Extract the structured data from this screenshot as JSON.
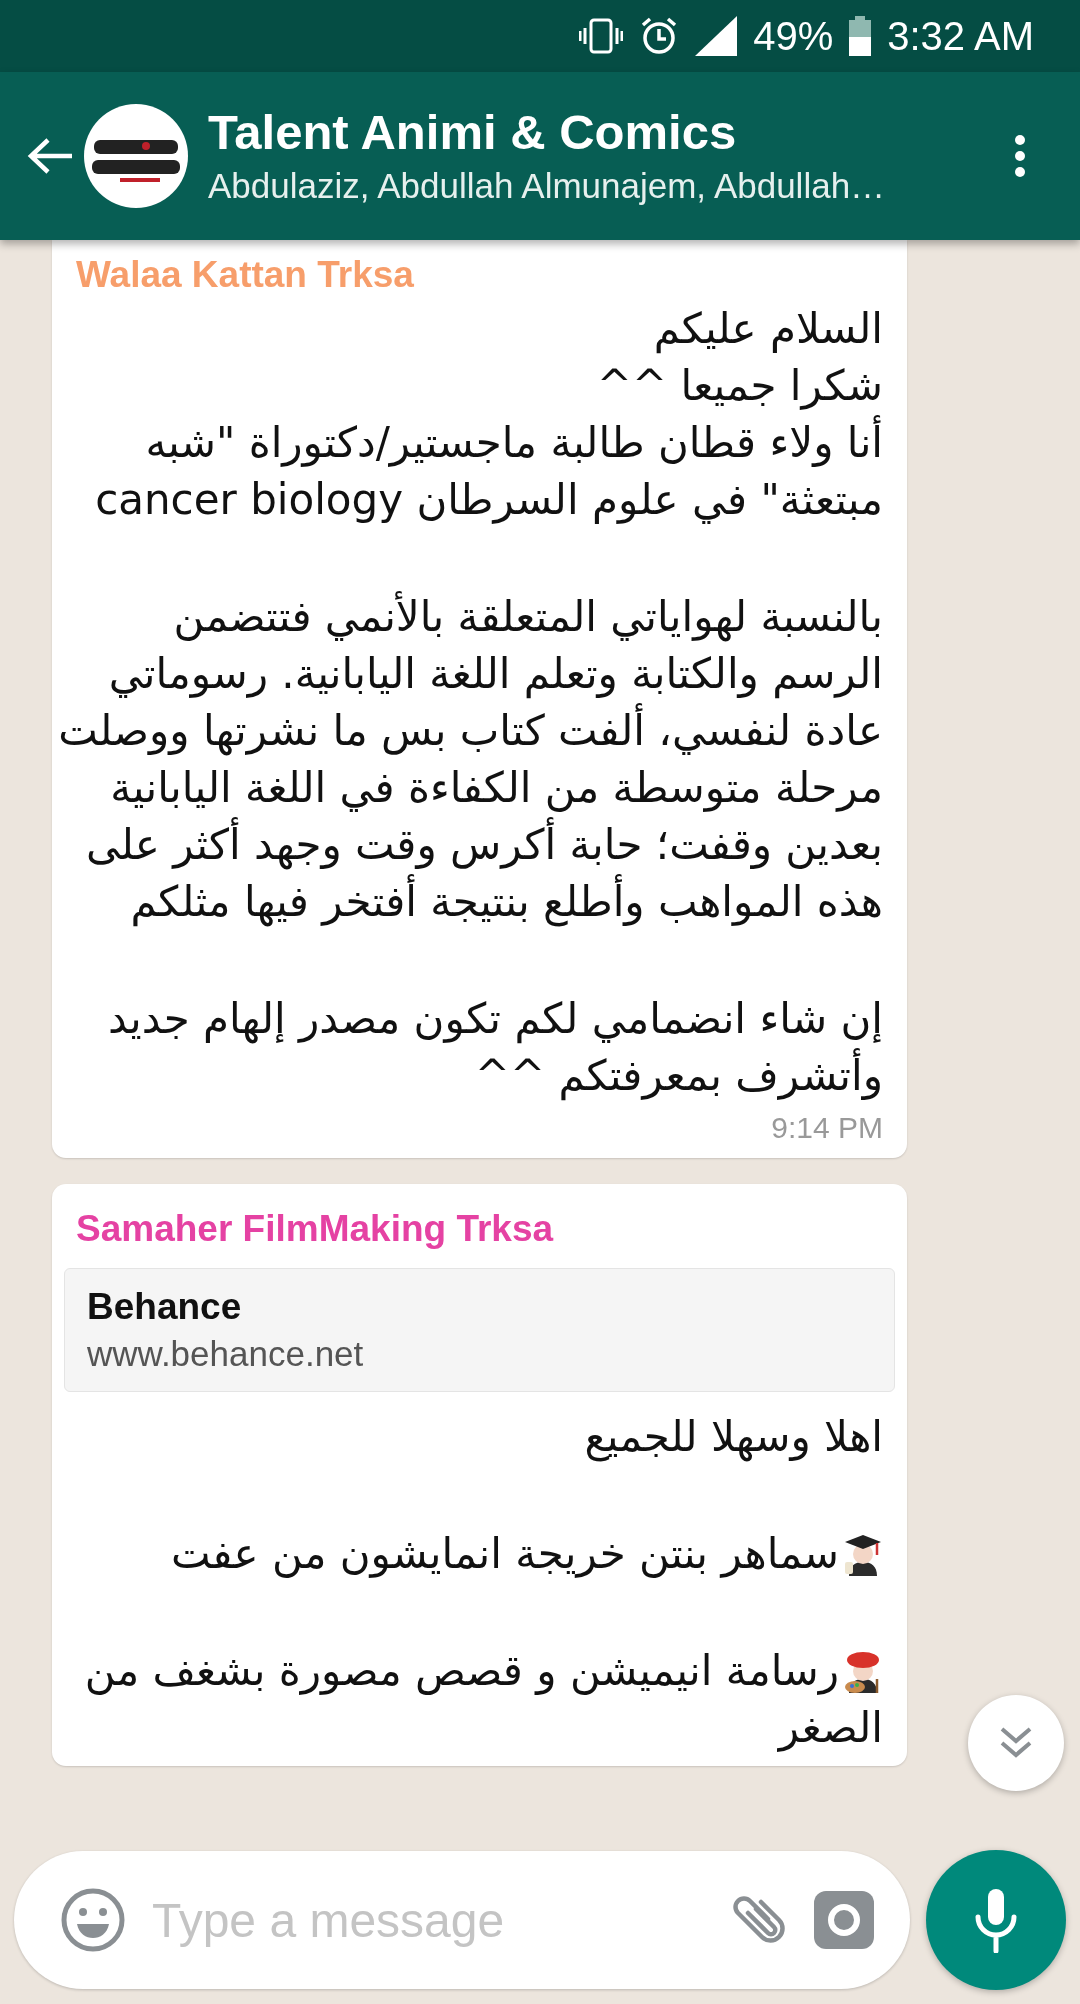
{
  "status_bar": {
    "battery": "49%",
    "time": "3:32 AM"
  },
  "header": {
    "title": "Talent Animi & Comics",
    "subtitle": "Abdulaziz, Abdullah Almunajem, Abdullah…"
  },
  "messages": [
    {
      "sender": "Walaa Kattan Trksa",
      "color": "#f79e6b",
      "paragraphs": [
        {
          "lines": [
            {
              "text": "السلام عليكم"
            },
            {
              "text": "شكرا جميعا ^^"
            },
            {
              "text": "أنا ولاء قطان طالبة ماجستير/دكتوراة \"شبه"
            },
            {
              "text": "مبتعثة\" في علوم السرطان cancer biology"
            }
          ]
        },
        {
          "lines": [
            {
              "text": "بالنسبة لهواياتي المتعلقة بالأنمي فتتضمن"
            },
            {
              "text": "الرسم والكتابة وتعلم اللغة اليابانية. رسوماتي"
            },
            {
              "text": "عادة لنفسي، ألفت كتاب بس ما نشرتها ووصلت"
            },
            {
              "text": "مرحلة متوسطة من الكفاءة في اللغة اليابانية"
            },
            {
              "text": "بعدين وقفت؛ حابة أكرس وقت وجهد أكثر على"
            },
            {
              "text": "هذه المواهب وأطلع بنتيجة أفتخر فيها مثلكم"
            }
          ]
        },
        {
          "lines": [
            {
              "text": "إن شاء انضمامي لكم تكون مصدر إلهام جديد"
            },
            {
              "text": "وأتشرف بمعرفتكم ^^"
            }
          ]
        }
      ],
      "time": "9:14 PM"
    },
    {
      "sender": "Samaher FilmMaking Trksa",
      "color": "#e542a3",
      "link_preview": {
        "title": "Behance",
        "url": "www.behance.net"
      },
      "paragraphs": [
        {
          "lines": [
            {
              "text": "اهلا وسهلا للجميع"
            }
          ]
        },
        {
          "lines": [
            {
              "text": "سماهر بنتن خريجة انمايشون من عفت",
              "kind": "graduate"
            }
          ]
        },
        {
          "lines": [
            {
              "text": "رسامة انيميشن و قصص مصورة بشغف من",
              "kind": "artist"
            },
            {
              "text": "الصغر"
            }
          ]
        }
      ]
    }
  ],
  "composer": {
    "placeholder": "Type a message"
  }
}
